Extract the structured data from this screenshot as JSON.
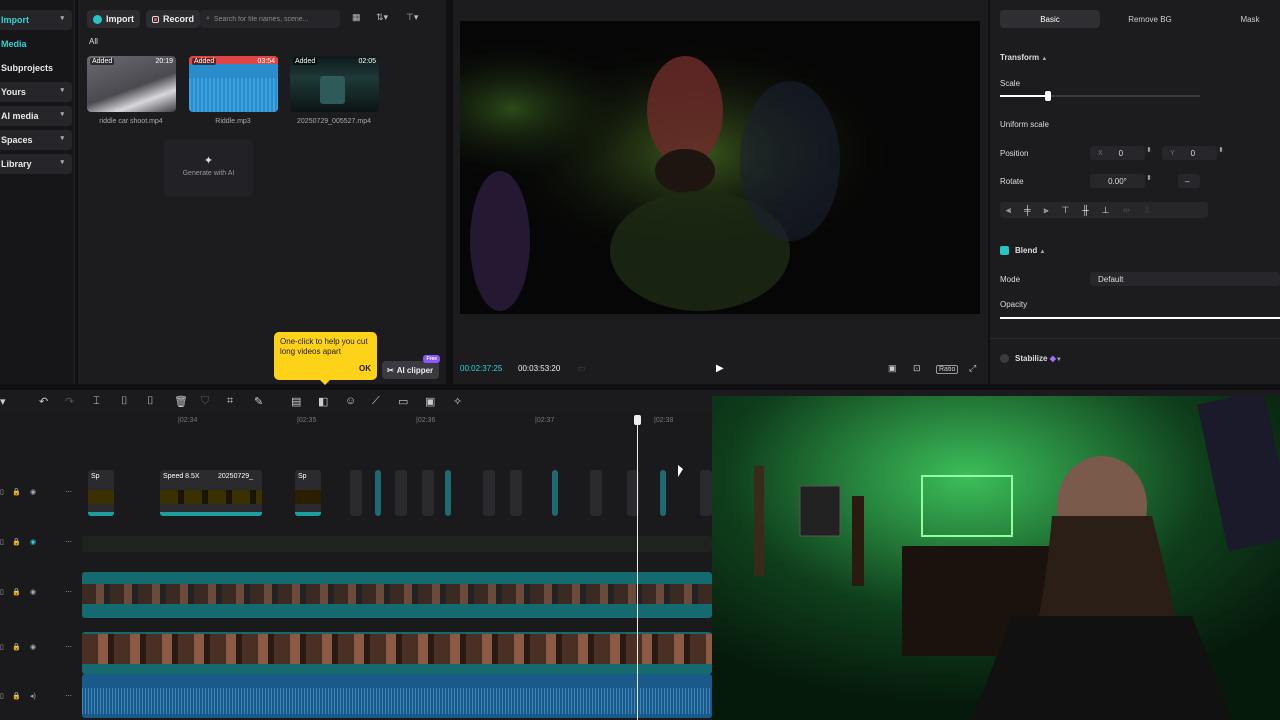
{
  "sidebar": {
    "items": [
      {
        "label": "Import",
        "active": true
      },
      {
        "label": "Media",
        "active": true
      },
      {
        "label": "Subprojects"
      },
      {
        "label": "Yours"
      },
      {
        "label": "AI media"
      },
      {
        "label": "Spaces"
      },
      {
        "label": "Library"
      }
    ]
  },
  "media": {
    "import_label": "Import",
    "record_label": "Record",
    "search_placeholder": "Search for file names, scene...",
    "filter_all": "All",
    "items": [
      {
        "badge": "Added",
        "duration": "20:19",
        "name": "riddle car shoot.mp4"
      },
      {
        "badge": "Added",
        "duration": "03:54",
        "name": "Riddle.mp3"
      },
      {
        "badge": "Added",
        "duration": "02:05",
        "name": "20250729_005527.mp4"
      }
    ],
    "generate_label": "Generate with AI",
    "tooltip_text": "One-click to help you cut long videos apart",
    "tooltip_ok": "OK",
    "ai_clipper_label": "AI clipper",
    "free_badge": "Free"
  },
  "player": {
    "current_time": "00:02:37:25",
    "total_time": "00:03:53:20",
    "ratio_label": "Ratio"
  },
  "properties": {
    "tabs": [
      "Basic",
      "Remove BG",
      "Mask"
    ],
    "transform_label": "Transform",
    "scale_label": "Scale",
    "scale_value": 0.24,
    "uniform_scale_label": "Uniform scale",
    "position_label": "Position",
    "position_x_label": "X",
    "position_x": "0",
    "position_y_label": "Y",
    "position_y": "0",
    "rotate_label": "Rotate",
    "rotate_value": "0.00°",
    "rotate_flip": "–",
    "blend_label": "Blend",
    "mode_label": "Mode",
    "mode_value": "Default",
    "opacity_label": "Opacity",
    "opacity_value": 1.0,
    "stabilize_label": "Stabilize"
  },
  "timeline": {
    "ruler_ticks": [
      "|02:34",
      "|02:35",
      "|02:36",
      "|02:37",
      "|02:38"
    ],
    "clip_label_1": "Sp",
    "clip_label_2": "Speed 8.5X",
    "clip_label_3": "20250729_",
    "clip_label_4": "Sp",
    "playhead_time": "00:02:37:25"
  },
  "colors": {
    "accent": "#26c4c4",
    "tooltip": "#ffd21a",
    "free_badge": "#8a56ff"
  }
}
